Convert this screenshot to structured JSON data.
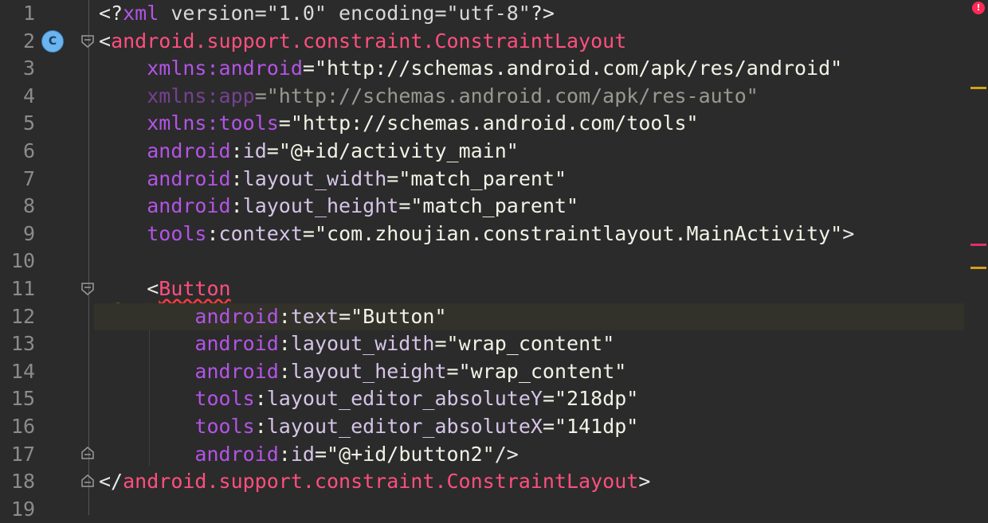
{
  "editor": {
    "line_numbers": [
      "1",
      "2",
      "3",
      "4",
      "5",
      "6",
      "7",
      "8",
      "9",
      "10",
      "11",
      "12",
      "13",
      "14",
      "15",
      "16",
      "17",
      "18",
      "19"
    ],
    "lines": {
      "l1": {
        "open": "<?",
        "xml": "xml",
        "rest": " version=\"1.0\" encoding=\"utf-8\"",
        "close": "?>"
      },
      "l2": {
        "open": "<",
        "tag": "android.support.constraint.ConstraintLayout"
      },
      "l3": {
        "ns": "xmlns:",
        "name": "android",
        "eq": "=",
        "value": "\"http://schemas.android.com/apk/res/android\""
      },
      "l4": {
        "ns": "xmlns:",
        "name": "app",
        "eq": "=",
        "value": "\"http://schemas.android.com/apk/res-auto\""
      },
      "l5": {
        "ns": "xmlns:",
        "name": "tools",
        "eq": "=",
        "value": "\"http://schemas.android.com/tools\""
      },
      "l6": {
        "ns": "android",
        "colon": ":",
        "name": "id",
        "eq": "=",
        "value": "\"@+id/activity_main\""
      },
      "l7": {
        "ns": "android",
        "colon": ":",
        "name": "layout_width",
        "eq": "=",
        "value": "\"match_parent\""
      },
      "l8": {
        "ns": "android",
        "colon": ":",
        "name": "layout_height",
        "eq": "=",
        "value": "\"match_parent\""
      },
      "l9": {
        "ns": "tools",
        "colon": ":",
        "name": "context",
        "eq": "=",
        "value": "\"com.zhoujian.constraintlayout.MainActivity\"",
        "close": ">"
      },
      "l11": {
        "open": "<",
        "tag": "Button"
      },
      "l12": {
        "ns": "android",
        "colon": ":",
        "name": "text",
        "eq": "=",
        "value": "\"Button\""
      },
      "l13": {
        "ns": "android",
        "colon": ":",
        "name": "layout_width",
        "eq": "=",
        "value": "\"wrap_content\""
      },
      "l14": {
        "ns": "android",
        "colon": ":",
        "name": "layout_height",
        "eq": "=",
        "value": "\"wrap_content\""
      },
      "l15": {
        "ns": "tools",
        "colon": ":",
        "name": "layout_editor_absoluteY",
        "eq": "=",
        "value": "\"218dp\""
      },
      "l16": {
        "ns": "tools",
        "colon": ":",
        "name": "layout_editor_absoluteX",
        "eq": "=",
        "value": "\"141dp\""
      },
      "l17": {
        "ns": "android",
        "colon": ":",
        "name": "id",
        "eq": "=",
        "value": "\"@+id/button2\"",
        "close": "/>"
      },
      "l18": {
        "open": "</",
        "tag": "android.support.constraint.ConstraintLayout",
        "close": ">"
      }
    }
  },
  "gutter": {
    "class_badge_letter": "C"
  },
  "scrollbar": {
    "error_symbol": "!"
  },
  "icons": [
    "fold-icon",
    "class-badge-icon",
    "intention-bulb-icon",
    "error-indicator-icon"
  ],
  "colors": {
    "background": "#2b2b2b",
    "tag": "#ff4f7e",
    "namespace": "#b354e6",
    "value": "#f2f2e6",
    "line_numbers": "#8b8b8b",
    "current_line": "#32322b",
    "warning_marker": "#d4a017",
    "error_marker": "#ff2a55"
  }
}
